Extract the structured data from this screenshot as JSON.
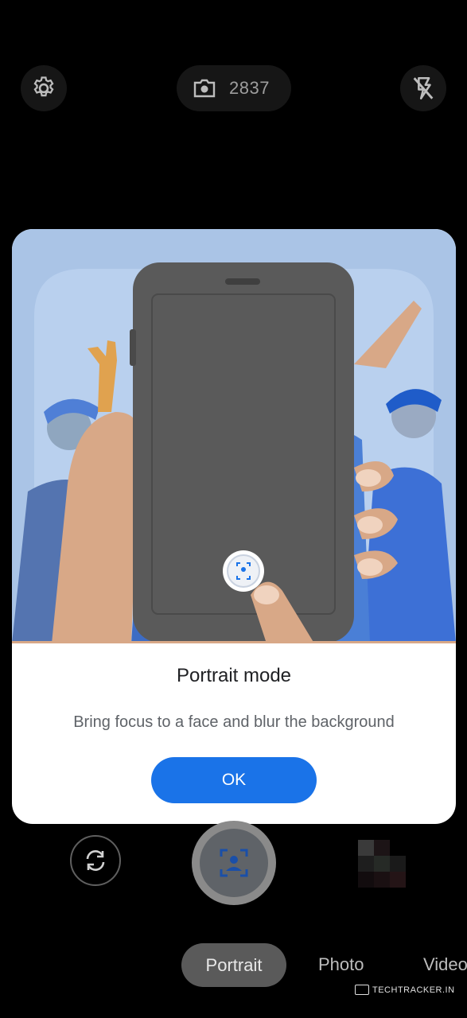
{
  "top_bar": {
    "settings_icon": "gear-icon",
    "photo_count": "2837",
    "counter_icon": "camera-icon",
    "flash_icon": "flash-off-icon"
  },
  "dialog": {
    "title": "Portrait mode",
    "body": "Bring focus to a face and blur the background",
    "ok_label": "OK",
    "illustration": "portrait-mode-illustration"
  },
  "controls": {
    "switch_camera_icon": "switch-camera-icon",
    "shutter_icon": "portrait-face-icon",
    "thumbnail": "last-photo-thumbnail"
  },
  "modes": {
    "portrait": "Portrait",
    "photo": "Photo",
    "video": "Video"
  },
  "watermark": {
    "text": "TECHTRACKER.IN"
  },
  "colors": {
    "accent": "#1a73e8",
    "background": "#000000",
    "dialog_bg": "#ffffff"
  }
}
